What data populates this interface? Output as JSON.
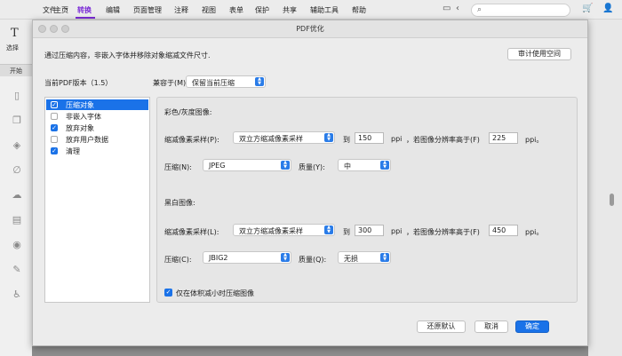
{
  "menubar": {
    "items": [
      "文件",
      "主页",
      "转换",
      "编辑",
      "页面管理",
      "注释",
      "视图",
      "表单",
      "保护",
      "共享",
      "辅助工具",
      "帮助"
    ],
    "file_arrow": "⌄"
  },
  "app_toolbar": {
    "select_label": "选择",
    "start_tab": "开始"
  },
  "dialog": {
    "title": "PDF优化",
    "description": "通过压缩内容，非嵌入字体并移除对象缩减文件尺寸.",
    "audit_button": "审计使用空间",
    "pdf_version_label": "当前PDF版本（1.5）",
    "compat_label": "兼容于(M):",
    "compat_value": "保留当前压缩",
    "list": [
      {
        "label": "压缩对象",
        "checked": true,
        "selected": true
      },
      {
        "label": "非嵌入字体",
        "checked": false,
        "selected": false
      },
      {
        "label": "放弃对象",
        "checked": true,
        "selected": false
      },
      {
        "label": "放弃用户数据",
        "checked": false,
        "selected": false
      },
      {
        "label": "清理",
        "checked": true,
        "selected": false
      }
    ],
    "color_section": {
      "heading": "彩色/灰度图像:",
      "downsample_label": "缩减像素采样(P):",
      "downsample_value": "双立方缩减像素采样",
      "to_label": "到",
      "ppi_value": "150",
      "ppi_unit": "ppi",
      "if_above_label": "，若图像分辨率高于(F)",
      "above_value": "225",
      "above_unit": "ppi。",
      "compress_label": "压缩(N):",
      "compress_value": "JPEG",
      "quality_label": "质量(Y):",
      "quality_value": "中"
    },
    "mono_section": {
      "heading": "黑白图像:",
      "downsample_label": "缩减像素采样(L):",
      "downsample_value": "双立方缩减像素采样",
      "to_label": "到",
      "ppi_value": "300",
      "ppi_unit": "ppi",
      "if_above_label": "，若图像分辨率高于(F)",
      "above_value": "450",
      "above_unit": "ppi。",
      "compress_label": "压缩(C):",
      "compress_value": "JBIG2",
      "quality_label": "质量(Q):",
      "quality_value": "无损"
    },
    "only_if_smaller_label": "仅在体积减小时压缩图像",
    "buttons": {
      "restore": "还原默认",
      "cancel": "取消",
      "ok": "确定"
    }
  }
}
